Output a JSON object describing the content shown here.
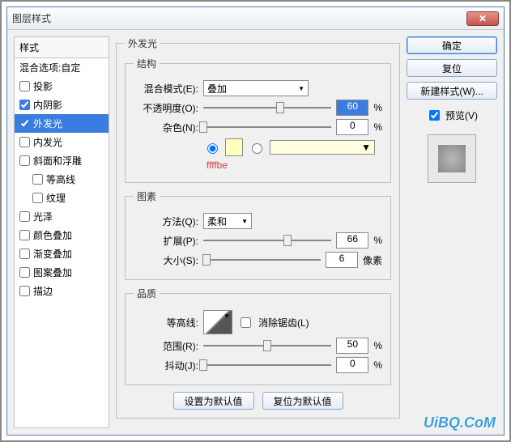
{
  "window": {
    "title": "图层样式"
  },
  "styles": {
    "header": "样式",
    "blend_options": "混合选项:自定",
    "items": [
      {
        "label": "投影",
        "checked": false
      },
      {
        "label": "内阴影",
        "checked": true
      },
      {
        "label": "外发光",
        "checked": true,
        "selected": true
      },
      {
        "label": "内发光",
        "checked": false
      },
      {
        "label": "斜面和浮雕",
        "checked": false
      },
      {
        "label": "等高线",
        "checked": false,
        "sub": true
      },
      {
        "label": "纹理",
        "checked": false,
        "sub": true
      },
      {
        "label": "光泽",
        "checked": false
      },
      {
        "label": "颜色叠加",
        "checked": false
      },
      {
        "label": "渐变叠加",
        "checked": false
      },
      {
        "label": "图案叠加",
        "checked": false
      },
      {
        "label": "描边",
        "checked": false
      }
    ]
  },
  "panel": {
    "title": "外发光",
    "structure": {
      "legend": "结构",
      "blend_mode_label": "混合模式(E):",
      "blend_mode_value": "叠加",
      "opacity_label": "不透明度(O):",
      "opacity_value": "60",
      "opacity_unit": "%",
      "noise_label": "杂色(N):",
      "noise_value": "0",
      "noise_unit": "%",
      "color_hex": "ffffbe"
    },
    "elements": {
      "legend": "图素",
      "technique_label": "方法(Q):",
      "technique_value": "柔和",
      "spread_label": "扩展(P):",
      "spread_value": "66",
      "spread_unit": "%",
      "size_label": "大小(S):",
      "size_value": "6",
      "size_unit": "像素"
    },
    "quality": {
      "legend": "品质",
      "contour_label": "等高线:",
      "antialias_label": "消除锯齿(L)",
      "range_label": "范围(R):",
      "range_value": "50",
      "range_unit": "%",
      "jitter_label": "抖动(J):",
      "jitter_value": "0",
      "jitter_unit": "%"
    },
    "defaults": {
      "set": "设置为默认值",
      "reset": "复位为默认值"
    }
  },
  "buttons": {
    "ok": "确定",
    "cancel": "复位",
    "new_style": "新建样式(W)...",
    "preview": "预览(V)"
  },
  "watermark": "UiBQ.CoM"
}
